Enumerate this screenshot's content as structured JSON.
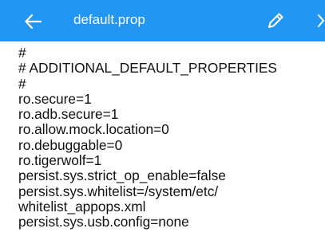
{
  "toolbar": {
    "title": "default.prop",
    "back_icon": "arrow-left-icon",
    "edit_icon": "pencil-icon",
    "background_color": "#2196f3"
  },
  "file": {
    "lines": [
      "#",
      "# ADDITIONAL_DEFAULT_PROPERTIES",
      "#",
      "ro.secure=1",
      "ro.adb.secure=1",
      "ro.allow.mock.location=0",
      "ro.debuggable=0",
      "ro.tigerwolf=1",
      "persist.sys.strict_op_enable=false",
      "persist.sys.whitelist=/system/etc/",
      "whitelist_appops.xml",
      "persist.sys.usb.config=none"
    ]
  }
}
